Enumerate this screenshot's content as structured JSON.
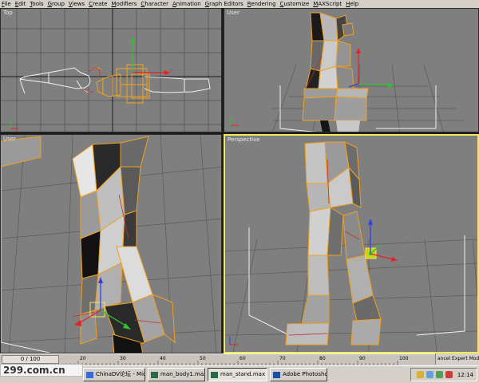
{
  "menu": [
    "File",
    "Edit",
    "Tools",
    "Group",
    "Views",
    "Create",
    "Modifiers",
    "Character",
    "Animation",
    "Graph Editors",
    "Rendering",
    "Customize",
    "MAXScript",
    "Help"
  ],
  "viewports": {
    "top": {
      "label": "Top"
    },
    "user": {
      "label": "User"
    },
    "user2": {
      "label": "User"
    },
    "perspective": {
      "label": "Perspective"
    }
  },
  "timeline": {
    "slider_text": "0 / 100",
    "ticks": [
      "20",
      "30",
      "40",
      "50",
      "60",
      "70",
      "80",
      "90",
      "100"
    ]
  },
  "status": {
    "right_text": "ancel Expert Mode"
  },
  "watermark": "299.com.cn",
  "taskbar": {
    "items": [
      {
        "label": "ChinaDV论坛 - Mic...",
        "icon_color": "#3a6ad8"
      },
      {
        "label": "man_body1.max - ...",
        "icon_color": "#2a6a4a"
      },
      {
        "label": "man_stand.max - ...",
        "icon_color": "#2a6a4a"
      },
      {
        "label": "Adobe Photoshop",
        "icon_color": "#1f4fa0"
      }
    ],
    "clock": "12:14",
    "tray_icons": [
      "#d8b03a",
      "#6aa0d8",
      "#5a9a5a",
      "#c84040"
    ]
  },
  "colors": {
    "viewport_bg": "#7f7f7f",
    "grid": "#5a5a5a",
    "wire_orange": "#f0a020",
    "active_border": "#f2e85a"
  }
}
